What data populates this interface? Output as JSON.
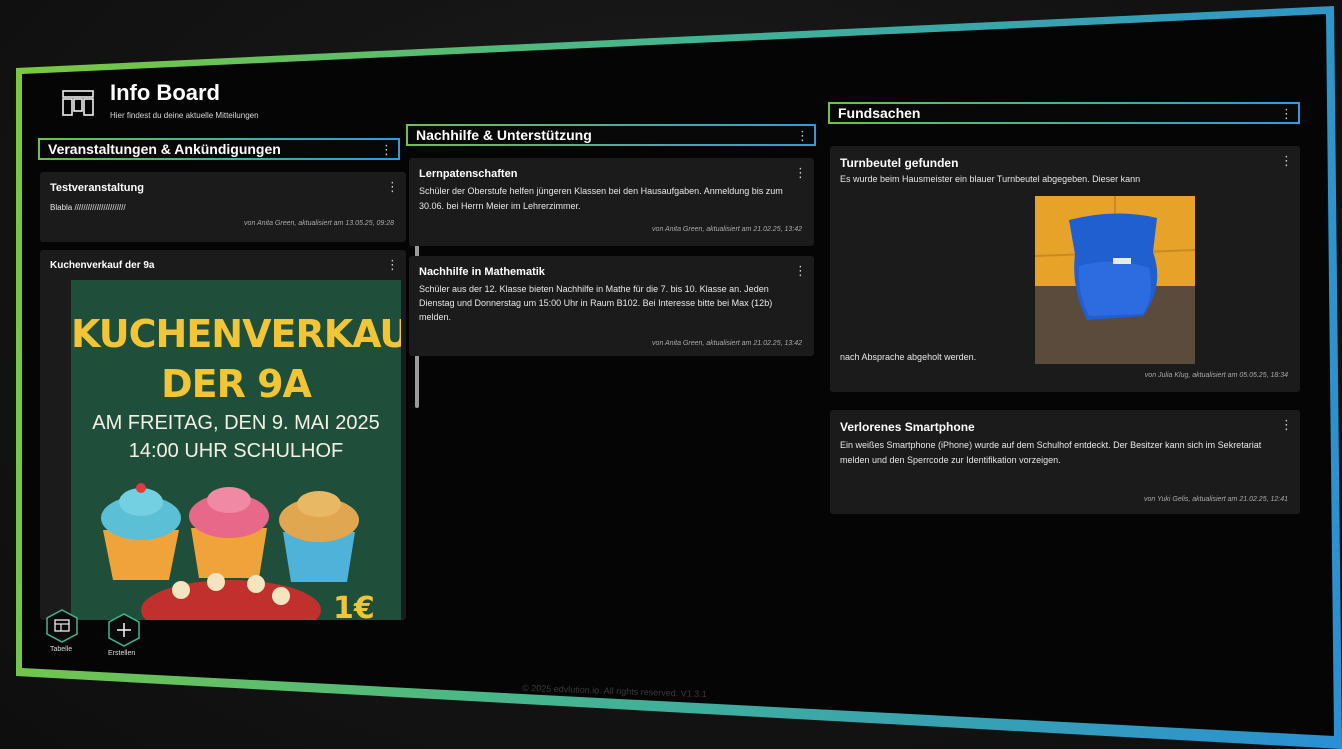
{
  "header": {
    "title": "Info Board",
    "subtitle": "Hier findest du deine aktuelle Mitteilungen"
  },
  "columns": [
    {
      "title": "Veranstaltungen & Ankündigungen",
      "cards": [
        {
          "title": "Testveranstaltung",
          "body": "Blabla ///////////////////////",
          "meta": "von Anita Green, aktualisiert am 13.05.25, 09:28"
        },
        {
          "title": "Kuchenverkauf der 9a"
        }
      ]
    },
    {
      "title": "Nachhilfe & Unterstützung",
      "cards": [
        {
          "title": "Lernpatenschaften",
          "body": "Schüler der Oberstufe helfen jüngeren Klassen bei den Hausaufgaben. Anmeldung bis zum 30.06. bei Herrn Meier im Lehrerzimmer.",
          "meta": "von Anita Green, aktualisiert am 21.02.25, 13:42"
        },
        {
          "title": "Nachhilfe in Mathematik",
          "body": "Schüler aus der 12. Klasse bieten Nachhilfe in Mathe für die 7. bis 10. Klasse an. Jeden Dienstag und Donnerstag um 15:00 Uhr in Raum B102. Bei Interesse bitte bei Max (12b) melden.",
          "meta": "von Anita Green, aktualisiert am 21.02.25, 13:42"
        }
      ]
    },
    {
      "title": "Fundsachen",
      "cards": [
        {
          "title": "Turnbeutel gefunden",
          "body": "Es wurde beim Hausmeister ein blauer Turnbeutel abgegeben. Dieser kann",
          "body_end": "nach Absprache abgeholt werden.",
          "meta": "von Julia Klug, aktualisiert am 05.05.25, 18:34"
        },
        {
          "title": "Verlorenes Smartphone",
          "body": "Ein weißes Smartphone (iPhone) wurde auf dem Schulhof entdeckt. Der Besitzer kann sich im Sekretariat melden und den Sperrcode zur Identifikation vorzeigen.",
          "meta": "von Yuki Gelis, aktualisiert am 21.02.25, 12:41"
        }
      ]
    }
  ],
  "poster": {
    "line1": "KUCHENVERKAUF",
    "line2": "DER 9A",
    "line3": "AM FREITAG, DEN 9. MAI 2025",
    "line4": "14:00 UHR  SCHULHOF",
    "corner": "1€"
  },
  "fabs": [
    {
      "label": "Tabelle",
      "icon": "table-icon"
    },
    {
      "label": "Erstellen",
      "icon": "plus-icon"
    }
  ],
  "footer": "© 2025 edvlution.io. All rights reserved. V1.3.1",
  "colors": {
    "accent_green": "#6cc24a",
    "accent_blue": "#2e9be0",
    "card": "#1b1b1b",
    "poster_bg": "#1f4f3a",
    "poster_title": "#f2c537"
  }
}
